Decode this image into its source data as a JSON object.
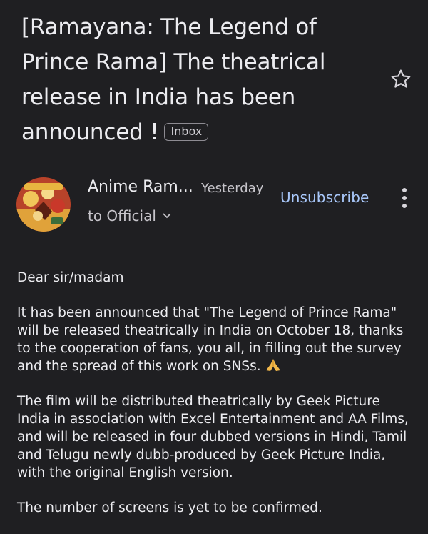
{
  "email": {
    "subject": "[Ramayana: The Legend of Prince Rama] The theatrical release in India has been announced !",
    "label_badge": "Inbox",
    "sender_name": "Anime Ram...",
    "time": "Yesterday",
    "to_line": "to Official",
    "unsubscribe_label": "Unsubscribe",
    "body": {
      "greeting": "Dear sir/madam",
      "p1": "It has been announced that \"The Legend of Prince Rama\" will be released theatrically in India on October 18, thanks to the cooperation of fans, you all, in filling out the survey and the spread of this work on SNSs.",
      "p2": "The film will be distributed theatrically by Geek Picture India in association with Excel Entertainment and AA Films, and will be released in four dubbed versions in Hindi, Tamil and Telugu newly dubb-produced by Geek Picture India, with the original English version.",
      "p3": "The number of screens is yet to be confirmed."
    }
  },
  "icons": {
    "star": "star-outline-icon",
    "chevron": "chevron-down-icon",
    "more": "more-vert-icon",
    "emoji": "folded-hands-emoji"
  },
  "colors": {
    "background": "#1f1f22",
    "link_blue": "#a8c7fa",
    "text": "#ececf0",
    "muted": "#c6c4ca"
  }
}
